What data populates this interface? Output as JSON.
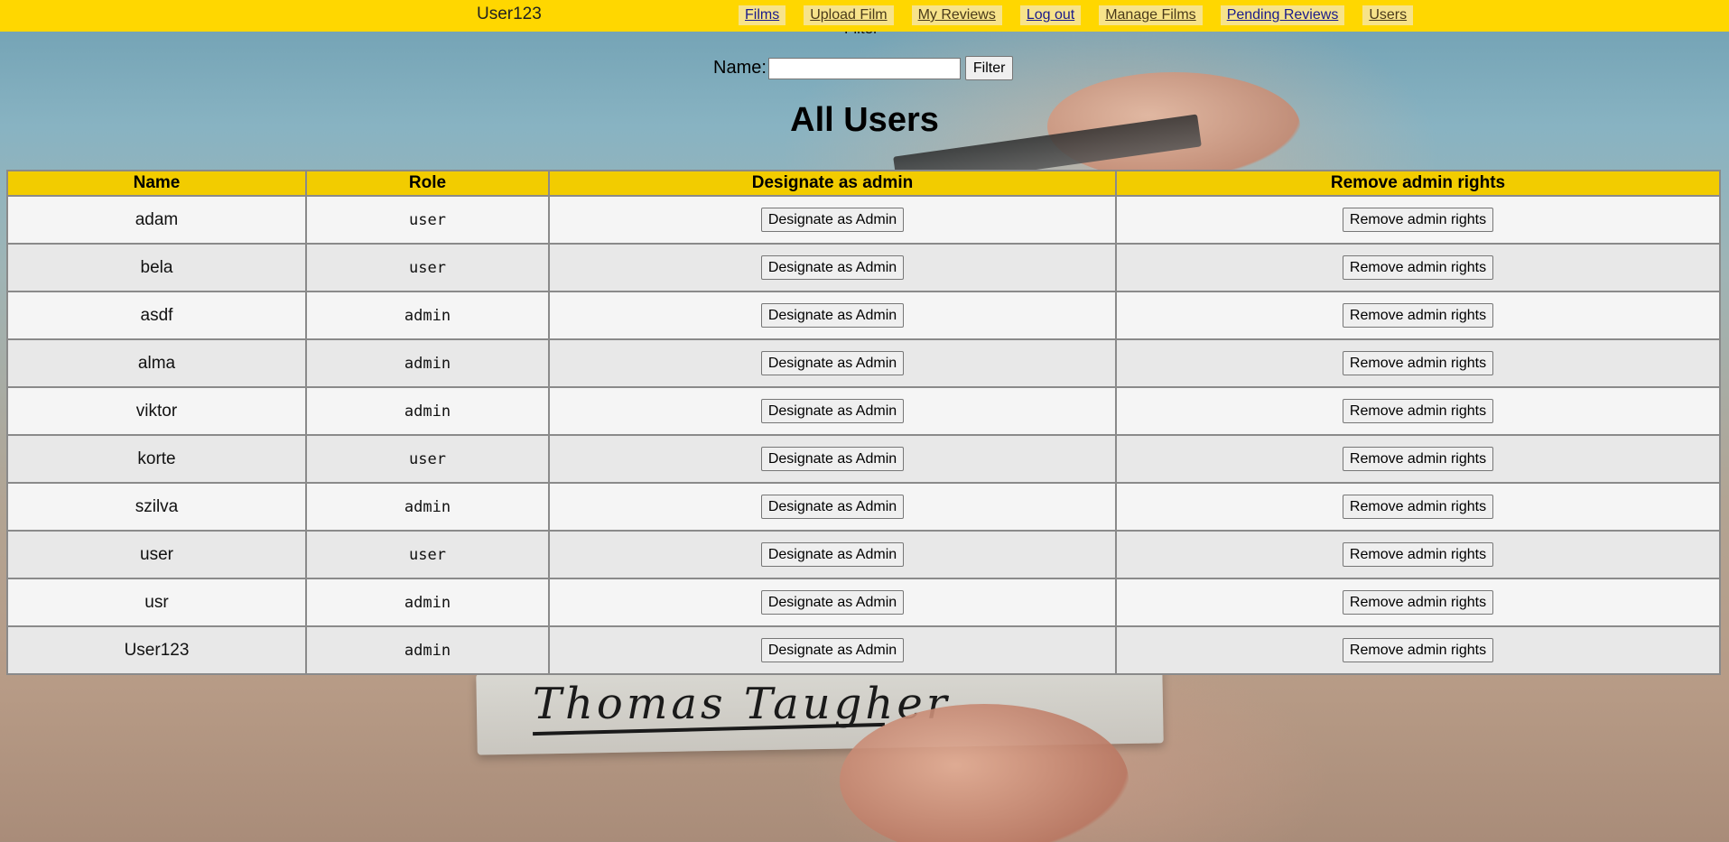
{
  "navbar": {
    "username": "User123",
    "links": [
      {
        "label": "Films"
      },
      {
        "label": "Upload Film"
      },
      {
        "label": "My Reviews"
      },
      {
        "label": "Log out"
      },
      {
        "label": "Manage Films"
      },
      {
        "label": "Pending Reviews"
      },
      {
        "label": "Users"
      }
    ],
    "bar_color": "#ffd700"
  },
  "filter": {
    "caption": "Filter",
    "label": "Name:",
    "input_value": "",
    "button_label": "Filter"
  },
  "page_title": "All Users",
  "table": {
    "headers": [
      "Name",
      "Role",
      "Designate as admin",
      "Remove admin rights"
    ],
    "designate_button_label": "Designate as Admin",
    "remove_button_label": "Remove admin rights",
    "header_color": "#f2cc00",
    "rows": [
      {
        "name": "adam",
        "role": "user"
      },
      {
        "name": "bela",
        "role": "user"
      },
      {
        "name": "asdf",
        "role": "admin"
      },
      {
        "name": "alma",
        "role": "admin"
      },
      {
        "name": "viktor",
        "role": "admin"
      },
      {
        "name": "korte",
        "role": "user"
      },
      {
        "name": "szilva",
        "role": "admin"
      },
      {
        "name": "user",
        "role": "user"
      },
      {
        "name": "usr",
        "role": "admin"
      },
      {
        "name": "User123",
        "role": "admin"
      }
    ]
  },
  "background": {
    "handwriting": "Thomas Taugher"
  }
}
